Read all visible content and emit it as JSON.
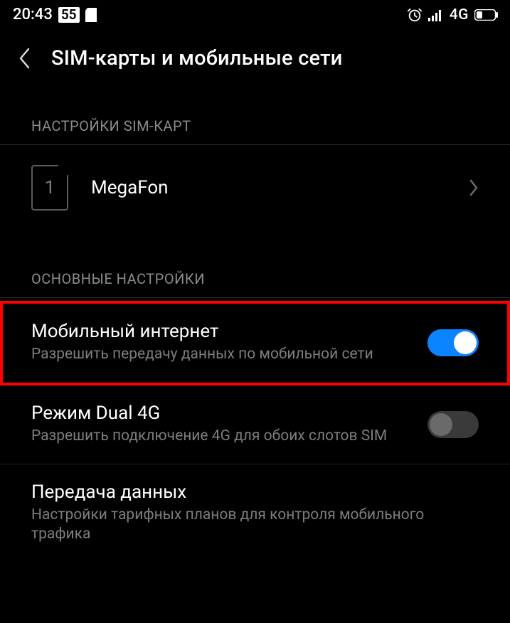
{
  "status_bar": {
    "time": "20:43",
    "badge": "55",
    "network_label": "4G"
  },
  "header": {
    "title": "SIM-карты и мобильные сети"
  },
  "sections": {
    "sim_settings": {
      "header": "НАСТРОЙКИ SIM-КАРТ"
    },
    "main_settings": {
      "header": "ОСНОВНЫЕ НАСТРОЙКИ"
    }
  },
  "sim": {
    "slot_number": "1",
    "carrier": "MegaFon"
  },
  "settings": {
    "mobile_data": {
      "title": "Мобильный интернет",
      "subtitle": "Разрешить передачу данных по мобильной сети",
      "enabled": true
    },
    "dual_4g": {
      "title": "Режим Dual 4G",
      "subtitle": "Разрешить подключение 4G для обоих слотов SIM",
      "enabled": false
    },
    "data_usage": {
      "title": "Передача данных",
      "subtitle": "Настройки тарифных планов для контроля мобильного трафика"
    }
  }
}
